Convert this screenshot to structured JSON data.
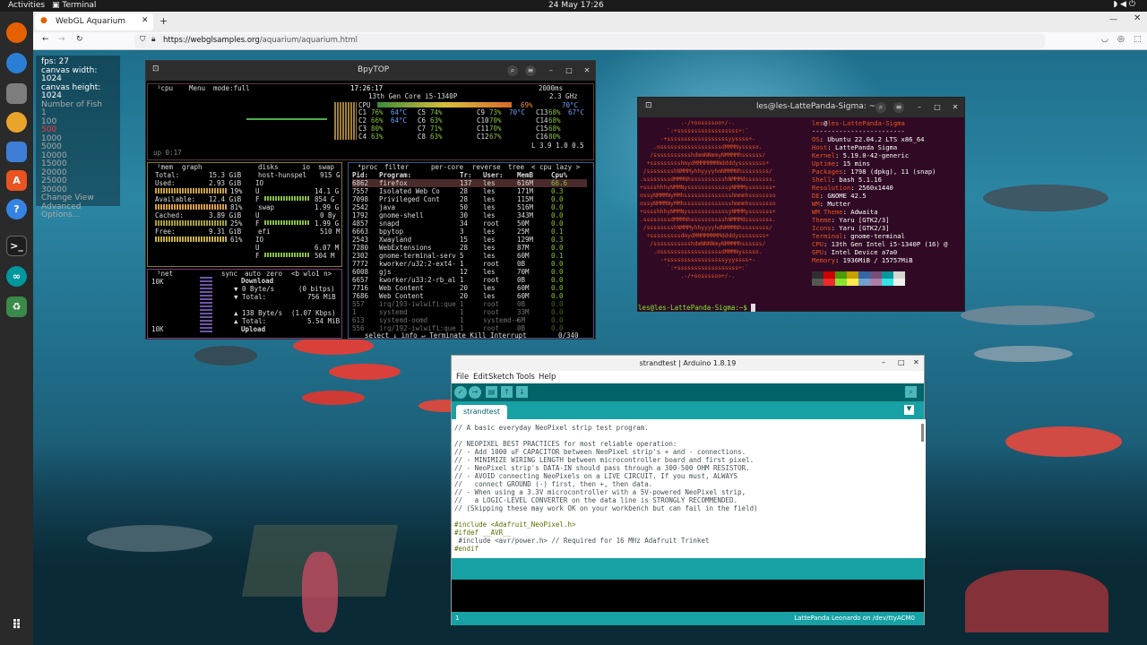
{
  "topbar": {
    "activities": "Activities",
    "app": "Terminal",
    "clock": "24 May  17:26"
  },
  "browser": {
    "tab_title": "WebGL Aquarium",
    "url_host": "https://webglsamples.org",
    "url_path": "/aquarium/aquarium.html"
  },
  "stats": {
    "fps": "fps: 27",
    "width": "canvas width: 1024",
    "height": "canvas height: 1024",
    "label": "Number of Fish",
    "options": [
      "1",
      "100",
      "500",
      "1000",
      "5000",
      "10000",
      "15000",
      "20000",
      "25000",
      "30000"
    ],
    "selected": "500",
    "extra": [
      "Change View",
      "Advanced",
      "Options..."
    ]
  },
  "btop": {
    "title": "BpyTOP",
    "cpu_label": "¹cpu",
    "menu": "Menu",
    "mode": "mode:full",
    "time": "17:26:17",
    "interval": "2000ms",
    "cpu_name": "13th Gen Core i5-1340P",
    "ghz": "2.3 GHz",
    "cpu_total": "CPU",
    "cpu_pct": "69%",
    "cpu_temp": "70°C",
    "cores": [
      {
        "c": "C1",
        "p": "76%",
        "t": "64°C"
      },
      {
        "c": "C2",
        "p": "66%",
        "t": "64°C"
      },
      {
        "c": "C3",
        "p": "80%",
        "t": ""
      },
      {
        "c": "C4",
        "p": "63%",
        "t": ""
      },
      {
        "c": "C5",
        "p": "74%",
        "t": ""
      },
      {
        "c": "C6",
        "p": "63%",
        "t": ""
      },
      {
        "c": "C7",
        "p": "71%",
        "t": ""
      },
      {
        "c": "C8",
        "p": "63%",
        "t": ""
      },
      {
        "c": "C9",
        "p": "73%",
        "t": "70°C"
      },
      {
        "c": "C10",
        "p": "70%",
        "t": ""
      },
      {
        "c": "C11",
        "p": "70%",
        "t": ""
      },
      {
        "c": "C12",
        "p": "67%",
        "t": ""
      },
      {
        "c": "C13",
        "p": "68%",
        "t": "67°C"
      },
      {
        "c": "C14",
        "p": "68%",
        "t": ""
      },
      {
        "c": "C15",
        "p": "68%",
        "t": ""
      },
      {
        "c": "C16",
        "p": "80%",
        "t": ""
      }
    ],
    "load": "L 3.9 1.0 0.5",
    "uptime": "up 0:17",
    "mem": {
      "hdr": "²mem",
      "graph": "graph",
      "total_l": "Total:",
      "total": "15.3 GiB",
      "used_l": "Used:",
      "used": "2.93 GiB",
      "used_p": "19%",
      "avail_l": "Available:",
      "avail": "12.4 GiB",
      "avail_p": "81%",
      "cached_l": "Cached:",
      "cached": "3.89 GiB",
      "cached_p": "25%",
      "free_l": "Free:",
      "free": "9.31 GiB",
      "free_p": "61%"
    },
    "disks": {
      "hdr": "disks",
      "io": "io",
      "swap": "swap",
      "d1": "host-hunspel",
      "d1v": "915 G",
      "d1a": "IO",
      "d1u": "U",
      "d1uv": "14.1 G",
      "d1f": "F",
      "d1fv": "854 G",
      "d2": "swap",
      "d2uv": "1.99 G",
      "d2u": "U",
      "d2f": "F",
      "d2uv2": "0 By",
      "d2fv": "1.99 G",
      "d3": "efi",
      "d3v": "510 M",
      "d3io": "IO",
      "d3u": "U",
      "d3uv": "6.07 M",
      "d3f": "F",
      "d3fv": "504 M"
    },
    "proc": {
      "hdr": "⁴proc",
      "filter": "filter",
      "percore": "per-core",
      "reverse": "reverse",
      "tree": "tree",
      "sort": "< cpu lazy >",
      "cols": [
        "Pid:",
        "Program:",
        "Tr:",
        "User:",
        "MemB",
        "Cpu%"
      ],
      "rows": [
        [
          "6862",
          "firefox",
          "137",
          "les",
          "616M",
          "66.6"
        ],
        [
          "7557",
          "Isolated Web Co",
          "28",
          "les",
          "171M",
          "0.3"
        ],
        [
          "7098",
          "Privileged Cont",
          "28",
          "les",
          "115M",
          "0.0"
        ],
        [
          "2542",
          "java",
          "50",
          "les",
          "516M",
          "0.0"
        ],
        [
          "1792",
          "gnome-shell",
          "30",
          "les",
          "343M",
          "0.0"
        ],
        [
          "4857",
          "snapd",
          "34",
          "root",
          "50M",
          "0.0"
        ],
        [
          "6663",
          "bpytop",
          "3",
          "les",
          "25M",
          "0.1"
        ],
        [
          "2543",
          "Xwayland",
          "15",
          "les",
          "129M",
          "0.3"
        ],
        [
          "7280",
          "WebExtensions",
          "28",
          "les",
          "87M",
          "0.0"
        ],
        [
          "2302",
          "gnome-terminal-serv",
          "5",
          "les",
          "60M",
          "0.1"
        ],
        [
          "7772",
          "kworker/u32:2-ext4-",
          "1",
          "root",
          "0B",
          "0.0"
        ],
        [
          "6008",
          "gjs",
          "12",
          "les",
          "70M",
          "0.0"
        ],
        [
          "6657",
          "kworker/u33:2-rb_al",
          "1",
          "root",
          "0B",
          "0.0"
        ],
        [
          "7716",
          "Web Content",
          "20",
          "les",
          "60M",
          "0.0"
        ],
        [
          "7686",
          "Web Content",
          "20",
          "les",
          "60M",
          "0.0"
        ],
        [
          "557",
          "irq/193-iwlwifi:que",
          "1",
          "root",
          "0B",
          "0.0"
        ],
        [
          "1",
          "systemd",
          "1",
          "root",
          "33M",
          "0.0"
        ],
        [
          "613",
          "systemd-oomd",
          "1",
          "systemd-+",
          "6M",
          "0.0"
        ],
        [
          "556",
          "irq/192-iwlwifi:que",
          "1",
          "root",
          "0B",
          "0.0"
        ]
      ],
      "foot": "select ↓ info ↵ Terminate Kill Interrupt",
      "count": "0/340"
    },
    "net": {
      "hdr": "³net",
      "sync": "sync",
      "auto": "auto",
      "zero": "zero",
      "iface": "<b wlo1 n>",
      "k1": "10K",
      "k2": "10K",
      "dl": "Download",
      "dl_rate": "0 Byte/s",
      "dl_bits": "(0 bitps)",
      "dl_total_l": "Total:",
      "dl_total": "756 MiB",
      "ul_rate": "138 Byte/s",
      "ul_bits": "(1.07 Kbps)",
      "ul_total_l": "Total:",
      "ul_total": "5.54 MiB",
      "ul": "Upload"
    }
  },
  "neofetch": {
    "title": "les@les-LattePanda-Sigma: ~",
    "user": "les",
    "at": "@",
    "host": "les-LattePanda-Sigma",
    "sep": "------------------------",
    "info": [
      [
        "OS",
        "Ubuntu 22.04.2 LTS x86_64"
      ],
      [
        "Host",
        "LattePanda Sigma"
      ],
      [
        "Kernel",
        "5.19.0-42-generic"
      ],
      [
        "Uptime",
        "15 mins"
      ],
      [
        "Packages",
        "1798 (dpkg), 11 (snap)"
      ],
      [
        "Shell",
        "bash 5.1.16"
      ],
      [
        "Resolution",
        "2560x1440"
      ],
      [
        "DE",
        "GNOME 42.5"
      ],
      [
        "WM",
        "Mutter"
      ],
      [
        "WM Theme",
        "Adwaita"
      ],
      [
        "Theme",
        "Yaru [GTK2/3]"
      ],
      [
        "Icons",
        "Yaru [GTK2/3]"
      ],
      [
        "Terminal",
        "gnome-terminal"
      ],
      [
        "CPU",
        "13th Gen Intel i5-1340P (16) @"
      ],
      [
        "GPU",
        "Intel Device a7a0"
      ],
      [
        "Memory",
        "1936MiB / 15757MiB"
      ]
    ],
    "logo": [
      "            .-/+oossssoo+/-.",
      "        `:+ssssssssssssssssss+:`",
      "      -+ssssssssssssssssssyyssss+-",
      "    .ossssssssssssssssssdMMMNysssso.",
      "   /ssssssssssshdmmNNmmyNMMMMhssssss/",
      "  +ssssssssshmydMMMMMMMNddddyssssssss+",
      " /sssssssshNMMMyhhyyyyhmNMMMNhssssssss/",
      ".ssssssssdMMMNhsssssssssshNMMMdssssssss.",
      "+sssshhhyNMMNyssssssssssssyNMMMysssssss+",
      "ossyNMMMNyMMhsssssssssssssshmmmhssssssso",
      "ossyNMMMNyMMhsssssssssssssshmmmhssssssso",
      "+sssshhhyNMMNyssssssssssssyNMMMysssssss+",
      ".ssssssssdMMMNhsssssssssshNMMMdssssssss.",
      " /sssssssshNMMMyhhyyyyhdNMMMNhssssssss/",
      "  +sssssssssdmydMMMMMMMMddddyssssssss+",
      "   /ssssssssssshdmNNNNmyNMMMMhssssss/",
      "    .ossssssssssssssssssdMMMNysssso.",
      "      -+sssssssssssssssssyyyssss+-",
      "        `:+ssssssssssssssssss+:`",
      "            .-/+oossssoo+/-."
    ],
    "prompt": "les@les-LattePanda-Sigma:~$ ",
    "palette": [
      "#2e2e2e",
      "#cc0000",
      "#4e9a06",
      "#c4a000",
      "#3465a4",
      "#75507b",
      "#06989a",
      "#d3d7cf",
      "#555753",
      "#ef2929",
      "#8ae234",
      "#fce94f",
      "#729fcf",
      "#ad7fa8",
      "#34e2e2",
      "#eeeeec"
    ]
  },
  "arduino": {
    "title": "strandtest | Arduino 1.8.19",
    "menus": [
      "File",
      "Edit",
      "Sketch",
      "Tools",
      "Help"
    ],
    "tab": "strandtest",
    "code": [
      "// A basic everyday NeoPixel strip test program.",
      "",
      "// NEOPIXEL BEST PRACTICES for most reliable operation:",
      "// - Add 1000 uF CAPACITOR between NeoPixel strip's + and - connections.",
      "// - MINIMIZE WIRING LENGTH between microcontroller board and first pixel.",
      "// - NeoPixel strip's DATA-IN should pass through a 300-500 OHM RESISTOR.",
      "// - AVOID connecting NeoPixels on a LIVE CIRCUIT. If you must, ALWAYS",
      "//   connect GROUND (-) first, then +, then data.",
      "// - When using a 3.3V microcontroller with a 5V-powered NeoPixel strip,",
      "//   a LOGIC-LEVEL CONVERTER on the data line is STRONGLY RECOMMENDED.",
      "// (Skipping these may work OK on your workbench but can fail in the field)",
      "",
      "#include <Adafruit_NeoPixel.h>",
      "#ifdef __AVR__",
      " #include <avr/power.h> // Required for 16 MHz Adafruit Trinket",
      "#endif"
    ],
    "line": "1",
    "board": "LattePanda Leonardo on /dev/ttyACM0"
  }
}
